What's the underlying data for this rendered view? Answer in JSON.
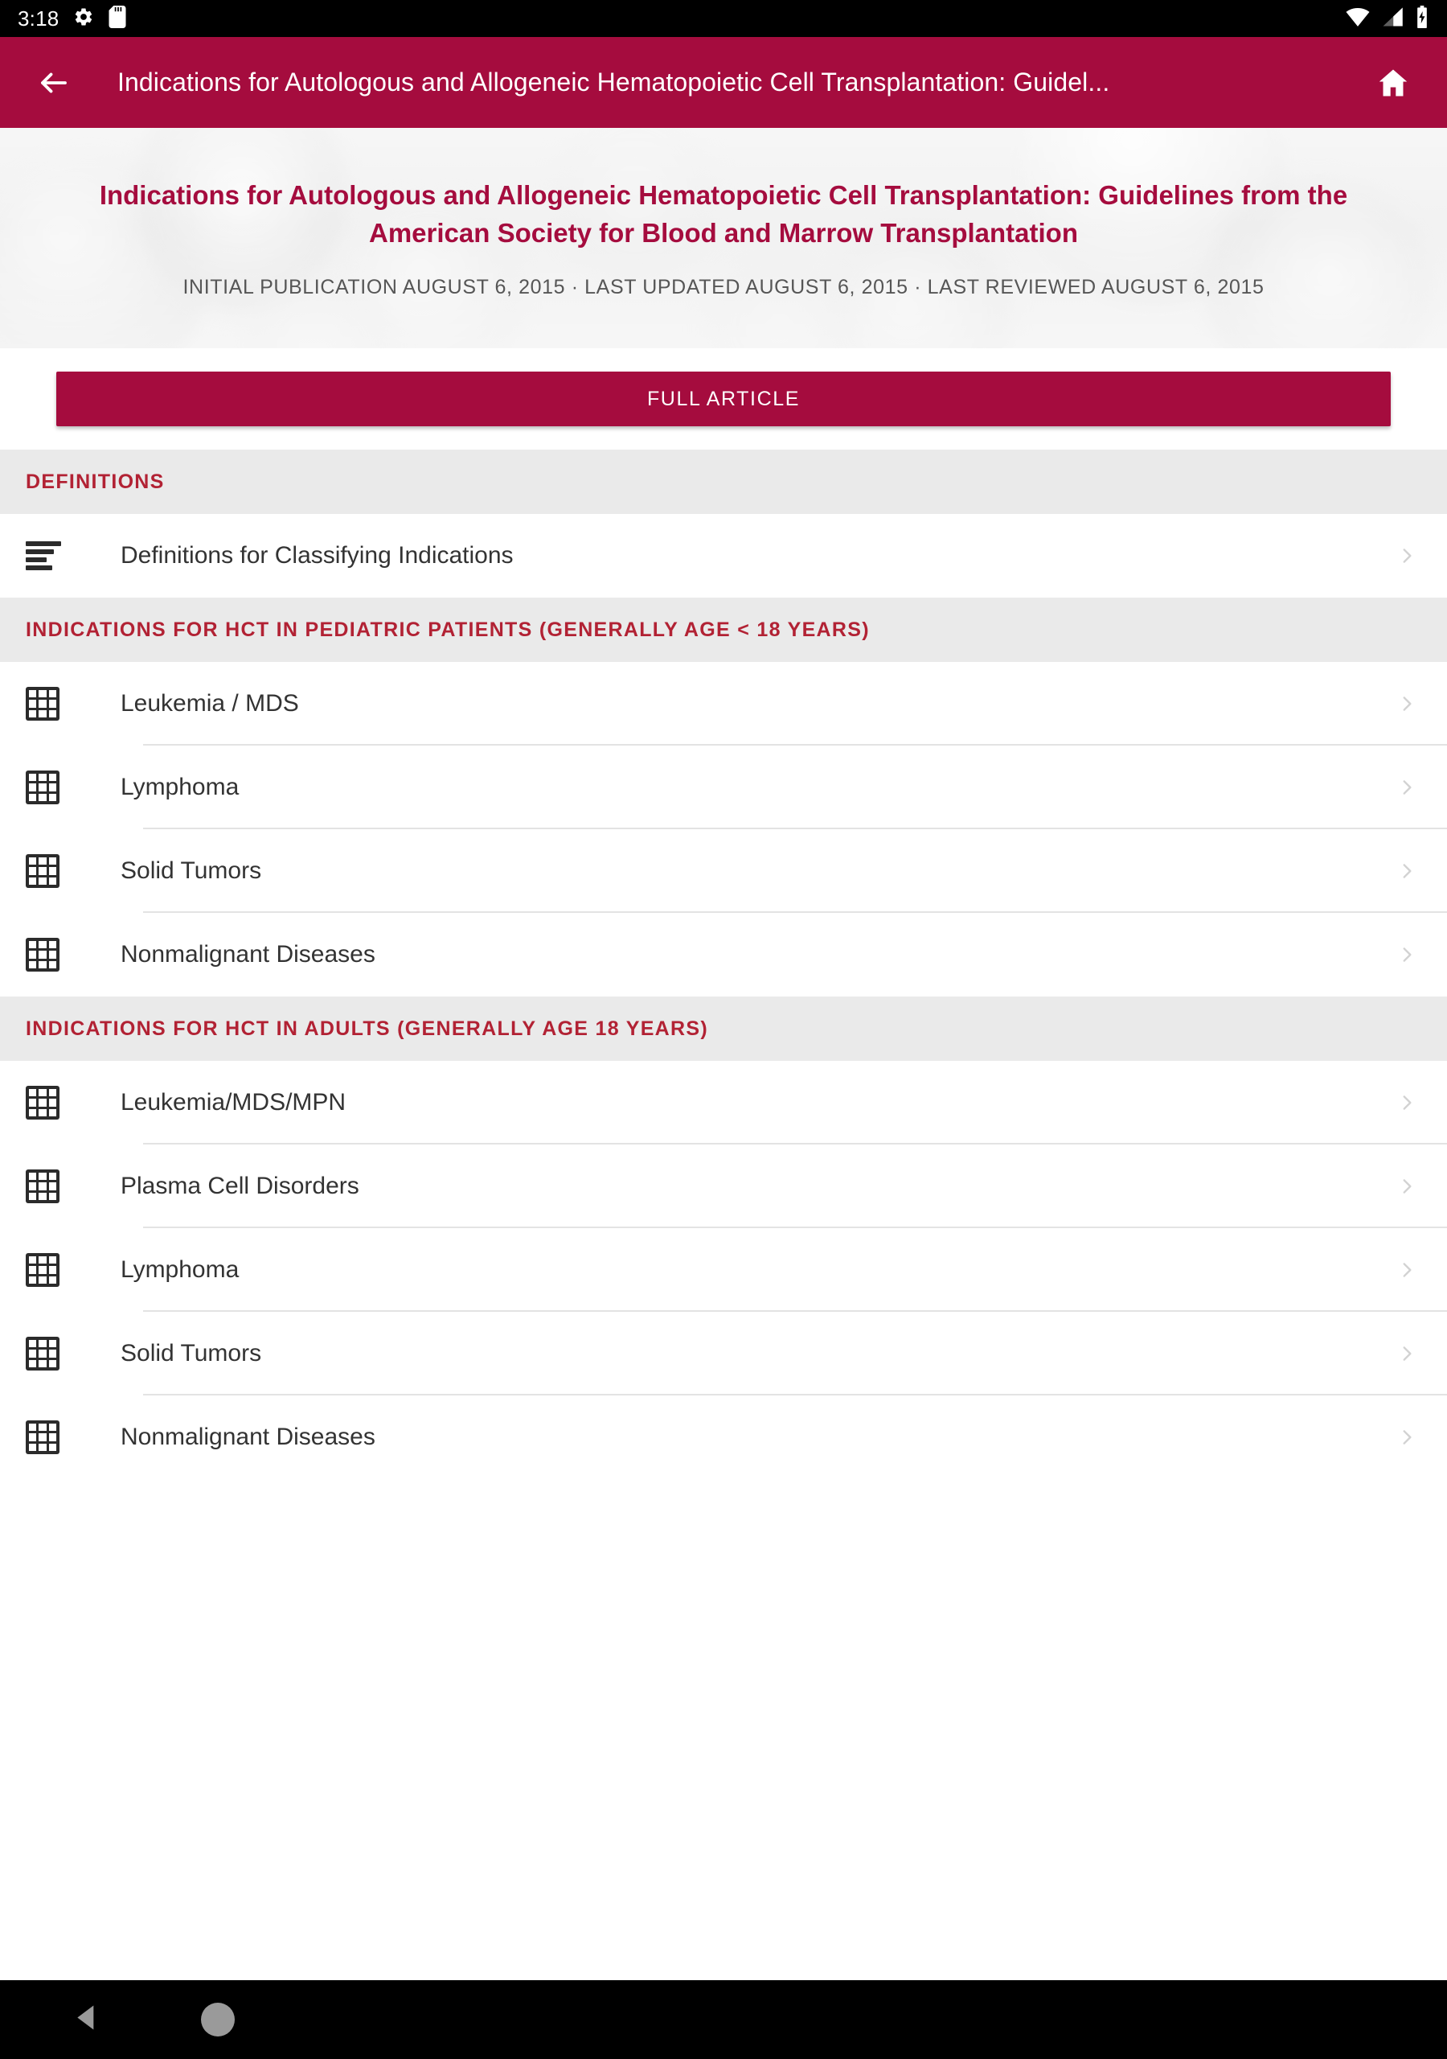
{
  "status_bar": {
    "time": "3:18",
    "left_icons": [
      "gear-icon",
      "sd-card-icon"
    ],
    "right_icons": [
      "wifi-icon",
      "cellular-signal-icon",
      "battery-charging-icon"
    ]
  },
  "app_bar": {
    "back_icon": "arrow-back-icon",
    "title": "Indications for Autologous and Allogeneic Hematopoietic Cell Transplantation: Guidel...",
    "home_icon": "home-icon",
    "background_color": "#a50c3e"
  },
  "hero": {
    "title": "Indications for Autologous and Allogeneic Hematopoietic Cell Transplantation: Guidelines from the American Society for Blood and Marrow Transplantation",
    "meta": "INITIAL PUBLICATION AUGUST 6, 2015 · LAST UPDATED AUGUST 6, 2015 · LAST REVIEWED AUGUST 6, 2015",
    "title_color": "#a50c3e"
  },
  "full_article_button": {
    "label": "FULL ARTICLE",
    "color": "#a50c3e"
  },
  "sections": [
    {
      "header": "DEFINITIONS",
      "items": [
        {
          "label": "Definitions for Classifying Indications",
          "icon": "subject-icon",
          "chevron": "chevron-right-icon"
        }
      ]
    },
    {
      "header": "INDICATIONS FOR HCT IN PEDIATRIC PATIENTS (GENERALLY AGE < 18 YEARS)",
      "items": [
        {
          "label": "Leukemia / MDS",
          "icon": "grid-table-icon",
          "chevron": "chevron-right-icon"
        },
        {
          "label": "Lymphoma",
          "icon": "grid-table-icon",
          "chevron": "chevron-right-icon"
        },
        {
          "label": "Solid Tumors",
          "icon": "grid-table-icon",
          "chevron": "chevron-right-icon"
        },
        {
          "label": "Nonmalignant Diseases",
          "icon": "grid-table-icon",
          "chevron": "chevron-right-icon"
        }
      ]
    },
    {
      "header": "INDICATIONS FOR HCT IN ADULTS (GENERALLY AGE 18 YEARS)",
      "items": [
        {
          "label": "Leukemia/MDS/MPN",
          "icon": "grid-table-icon",
          "chevron": "chevron-right-icon"
        },
        {
          "label": "Plasma Cell Disorders",
          "icon": "grid-table-icon",
          "chevron": "chevron-right-icon"
        },
        {
          "label": "Lymphoma",
          "icon": "grid-table-icon",
          "chevron": "chevron-right-icon"
        },
        {
          "label": "Solid Tumors",
          "icon": "grid-table-icon",
          "chevron": "chevron-right-icon"
        },
        {
          "label": "Nonmalignant Diseases",
          "icon": "grid-table-icon",
          "chevron": "chevron-right-icon"
        }
      ]
    }
  ],
  "nav_bar": {
    "back_icon": "nav-back-triangle-icon",
    "home_icon": "nav-home-circle-icon"
  },
  "colors": {
    "brand": "#a50c3e",
    "section_header_text": "#b22234",
    "section_header_bg": "#eaeaea",
    "row_text": "#333333",
    "divider": "#e3e3e3"
  }
}
